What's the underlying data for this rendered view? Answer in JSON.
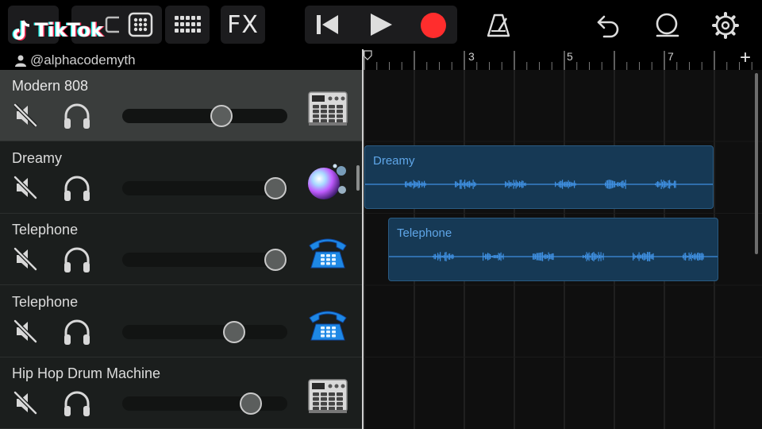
{
  "watermark": {
    "brand": "TikTok",
    "handle": "@alphacodemyth"
  },
  "toolbar": {
    "fx_label": "FX",
    "buttons": [
      "browser-button",
      "tracks-view-button",
      "mixer-button",
      "fx-button",
      "rewind-button",
      "play-button",
      "record-button",
      "metronome-button",
      "undo-button",
      "loop-button",
      "settings-button"
    ],
    "record_color": "#ff2d2d"
  },
  "ruler": {
    "markers": [
      "3",
      "5",
      "7"
    ],
    "add_label": "+"
  },
  "tracks": [
    {
      "name": "Modern 808",
      "volume": 0.6,
      "icon": "drum-machine-icon",
      "selected": true
    },
    {
      "name": "Dreamy",
      "volume": 0.93,
      "icon": "bubble-synth-icon",
      "selected": false
    },
    {
      "name": "Telephone",
      "volume": 0.93,
      "icon": "telephone-icon",
      "selected": false
    },
    {
      "name": "Telephone",
      "volume": 0.68,
      "icon": "telephone-icon",
      "selected": false
    },
    {
      "name": "Hip Hop Drum Machine",
      "volume": 0.78,
      "icon": "drum-machine-icon",
      "selected": false
    }
  ],
  "regions": [
    {
      "label": "Dreamy",
      "track": 1
    },
    {
      "label": "Telephone",
      "track": 2
    }
  ],
  "colors": {
    "accent": "#5fa6e8",
    "region_fill": "#163955",
    "waveform": "#3f8fe0"
  }
}
